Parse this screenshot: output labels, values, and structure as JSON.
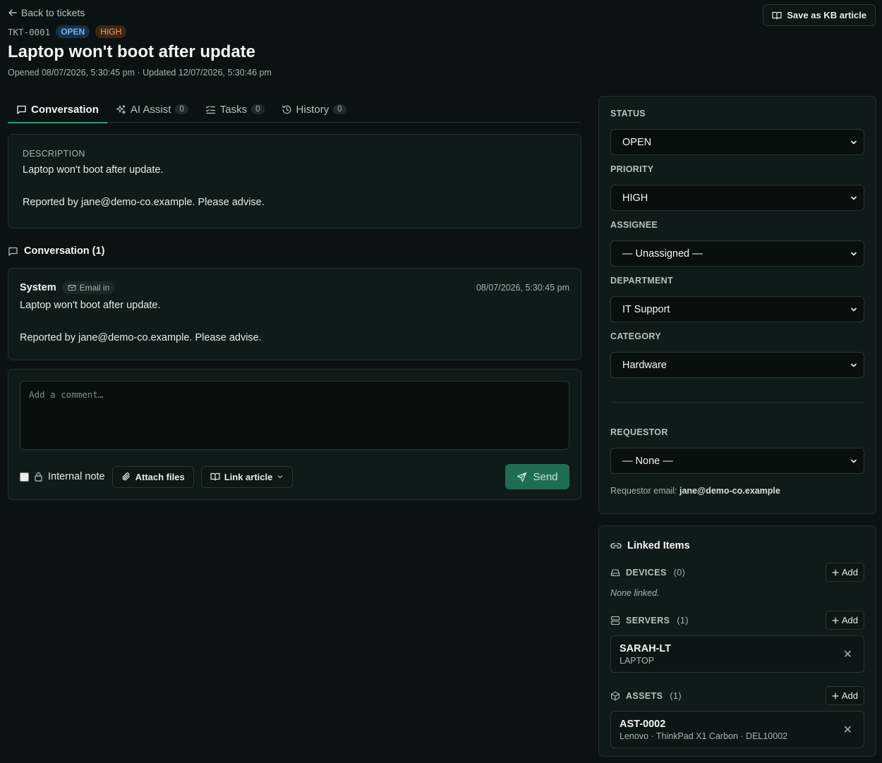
{
  "header": {
    "back_label": "Back to tickets",
    "ticket_id": "TKT-0001",
    "status_badge": "OPEN",
    "priority_badge": "HIGH",
    "title": "Laptop won't boot after update",
    "dates": "Opened 08/07/2026, 5:30:45 pm · Updated 12/07/2026, 5:30:46 pm",
    "kb_button": "Save as KB article"
  },
  "tabs": [
    {
      "label": "Conversation",
      "count": null
    },
    {
      "label": "AI Assist",
      "count": "0"
    },
    {
      "label": "Tasks",
      "count": "0"
    },
    {
      "label": "History",
      "count": "0"
    }
  ],
  "description": {
    "label": "DESCRIPTION",
    "line1": "Laptop won't boot after update.",
    "line2": "Reported by jane@demo-co.example. Please advise."
  },
  "conversation": {
    "heading": "Conversation (1)",
    "message": {
      "author": "System",
      "channel": "Email in",
      "time": "08/07/2026, 5:30:45 pm",
      "line1": "Laptop won't boot after update.",
      "line2": "Reported by jane@demo-co.example. Please advise."
    }
  },
  "comment": {
    "placeholder": "Add a comment…",
    "internal_note": "Internal note",
    "attach": "Attach files",
    "link_article": "Link article",
    "send": "Send"
  },
  "properties": {
    "status": {
      "label": "STATUS",
      "value": "OPEN"
    },
    "priority": {
      "label": "PRIORITY",
      "value": "HIGH"
    },
    "assignee": {
      "label": "ASSIGNEE",
      "value": "— Unassigned —"
    },
    "department": {
      "label": "DEPARTMENT",
      "value": "IT Support"
    },
    "category": {
      "label": "CATEGORY",
      "value": "Hardware"
    },
    "requestor": {
      "label": "REQUESTOR",
      "value": "— None —"
    },
    "requestor_email_label": "Requestor email:",
    "requestor_email": "jane@demo-co.example"
  },
  "linked": {
    "title": "Linked Items",
    "add_label": "Add",
    "devices": {
      "name": "DEVICES",
      "count": "(0)",
      "empty": "None linked."
    },
    "servers": {
      "name": "SERVERS",
      "count": "(1)",
      "items": [
        {
          "name": "SARAH-LT",
          "sub": "LAPTOP"
        }
      ]
    },
    "assets": {
      "name": "ASSETS",
      "count": "(1)",
      "items": [
        {
          "name": "AST-0002",
          "sub": "Lenovo · ThinkPad X1 Carbon · DEL10002"
        }
      ]
    }
  },
  "colors": {
    "background": "#0a1311",
    "accent": "#2f9b79",
    "send_button": "#1f6e54",
    "open_badge": "#7fb2f0",
    "high_badge": "#f0a463"
  }
}
